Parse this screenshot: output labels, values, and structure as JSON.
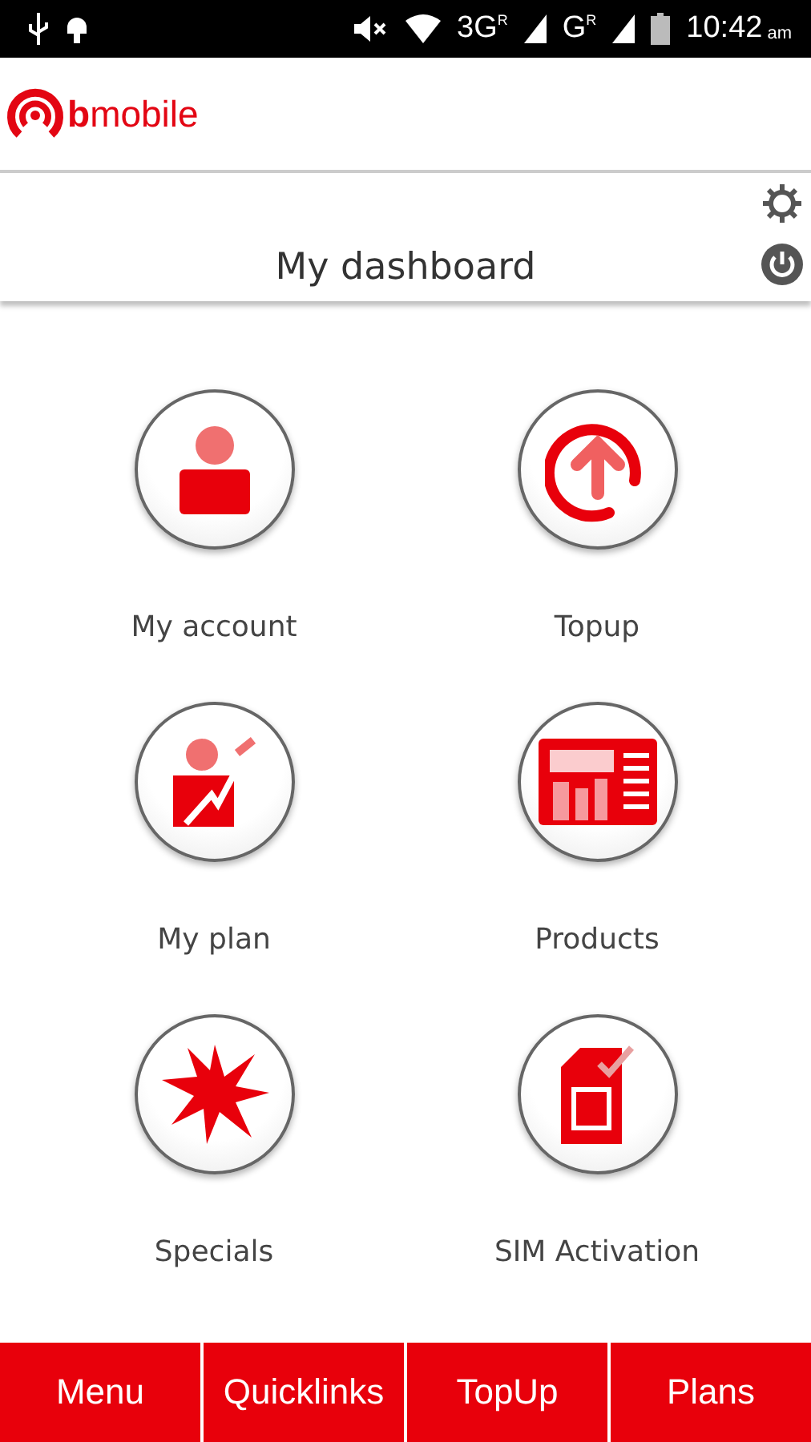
{
  "status_bar": {
    "network_1": "3G$^{R}$",
    "network_2": "G$^{R}$",
    "time": "10:42",
    "meridiem": "am"
  },
  "header": {
    "logo": "**b**mobile"
  },
  "title_bar": {
    "title": "My dashboard"
  },
  "tiles": [
    {
      "label": "My account",
      "kind": "account"
    },
    {
      "label": "Topup",
      "kind": "topup"
    },
    {
      "label": "My plan",
      "kind": "plan"
    },
    {
      "label": "Products",
      "kind": "products"
    },
    {
      "label": "Specials",
      "kind": "specials"
    },
    {
      "label": "SIM Activation",
      "kind": "sim"
    }
  ],
  "bottom_tabs": [
    {
      "label": "Menu"
    },
    {
      "label": "Quicklinks"
    },
    {
      "label": "TopUp"
    },
    {
      "label": "Plans"
    }
  ]
}
